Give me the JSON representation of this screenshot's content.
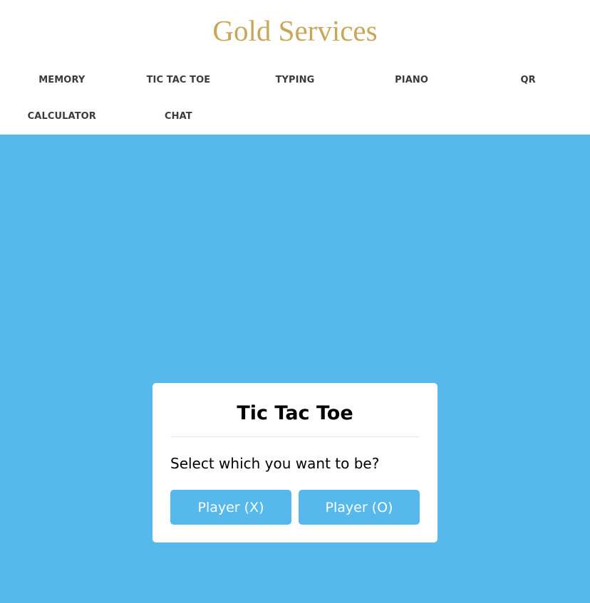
{
  "site": {
    "title": "Gold Services"
  },
  "nav": {
    "items": [
      {
        "label": "MEMORY"
      },
      {
        "label": "TIC TAC TOE"
      },
      {
        "label": "TYPING"
      },
      {
        "label": "PIANO"
      },
      {
        "label": "QR"
      },
      {
        "label": "CALCULATOR"
      },
      {
        "label": "CHAT"
      }
    ]
  },
  "game": {
    "title": "Tic Tac Toe",
    "prompt": "Select which you want to be?",
    "options": [
      {
        "label": "Player (X)"
      },
      {
        "label": "Player (O)"
      }
    ]
  },
  "colors": {
    "brand_gold": "#c9a75a",
    "background_blue": "#56b8eb",
    "nav_text": "#3b3b3b"
  }
}
